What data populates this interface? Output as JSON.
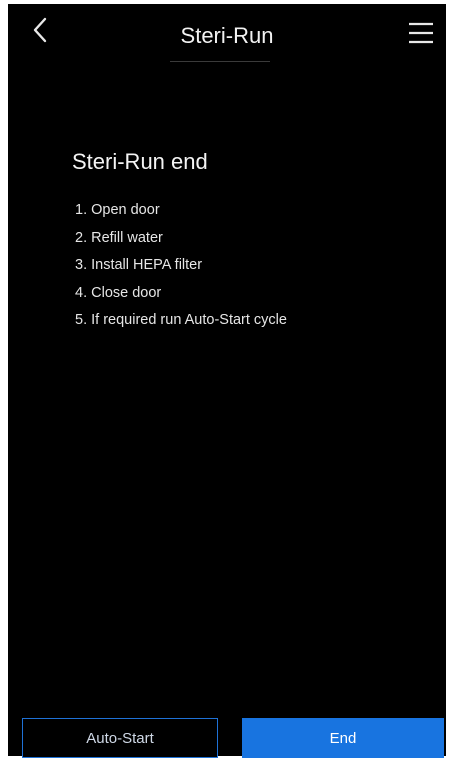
{
  "header": {
    "title": "Steri-Run",
    "back_icon": "chevron-left-icon",
    "menu_icon": "hamburger-menu-icon"
  },
  "main": {
    "heading": "Steri-Run end",
    "steps": [
      "1. Open door",
      "2. Refill water",
      "3. Install HEPA filter",
      "4. Close door",
      "5. If required run Auto-Start cycle"
    ]
  },
  "footer": {
    "autostart_label": "Auto-Start",
    "end_label": "End"
  },
  "colors": {
    "background": "#000000",
    "accent": "#1874e0",
    "text": "#ffffff"
  }
}
